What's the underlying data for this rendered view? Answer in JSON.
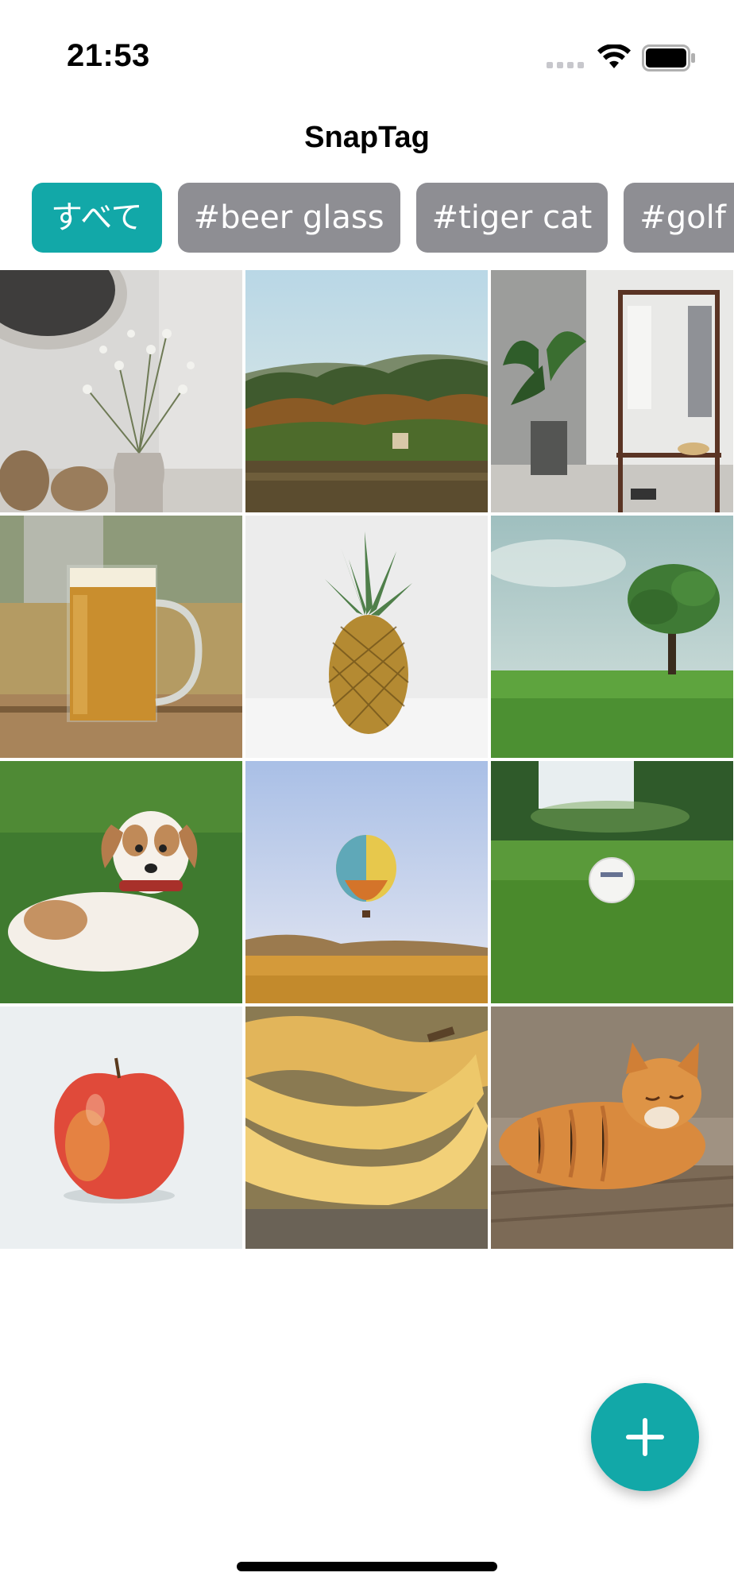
{
  "status_bar": {
    "time": "21:53",
    "signal_icon": "cellular-dots-icon",
    "wifi_icon": "wifi-icon",
    "battery_icon": "battery-full-icon"
  },
  "nav": {
    "title": "SnapTag"
  },
  "tags": [
    {
      "label": "すべて",
      "active": true
    },
    {
      "label": "#beer glass",
      "active": false
    },
    {
      "label": "#tiger cat",
      "active": false
    },
    {
      "label": "#golf ball",
      "active": false
    }
  ],
  "colors": {
    "accent": "#12a8a8",
    "chip_inactive": "#8e8e93",
    "chip_text": "#ffffff"
  },
  "photos": [
    {
      "subject": "vase-with-flowers-photo"
    },
    {
      "subject": "lake-forest-photo"
    },
    {
      "subject": "room-plant-clothes-rack-photo"
    },
    {
      "subject": "beer-glass-photo"
    },
    {
      "subject": "pineapple-photo"
    },
    {
      "subject": "tree-on-grass-photo"
    },
    {
      "subject": "puppy-on-grass-photo"
    },
    {
      "subject": "hot-air-balloon-photo"
    },
    {
      "subject": "golf-ball-photo"
    },
    {
      "subject": "apple-photo"
    },
    {
      "subject": "bananas-photo"
    },
    {
      "subject": "tabby-cat-photo"
    }
  ],
  "fab": {
    "icon": "plus-icon"
  }
}
